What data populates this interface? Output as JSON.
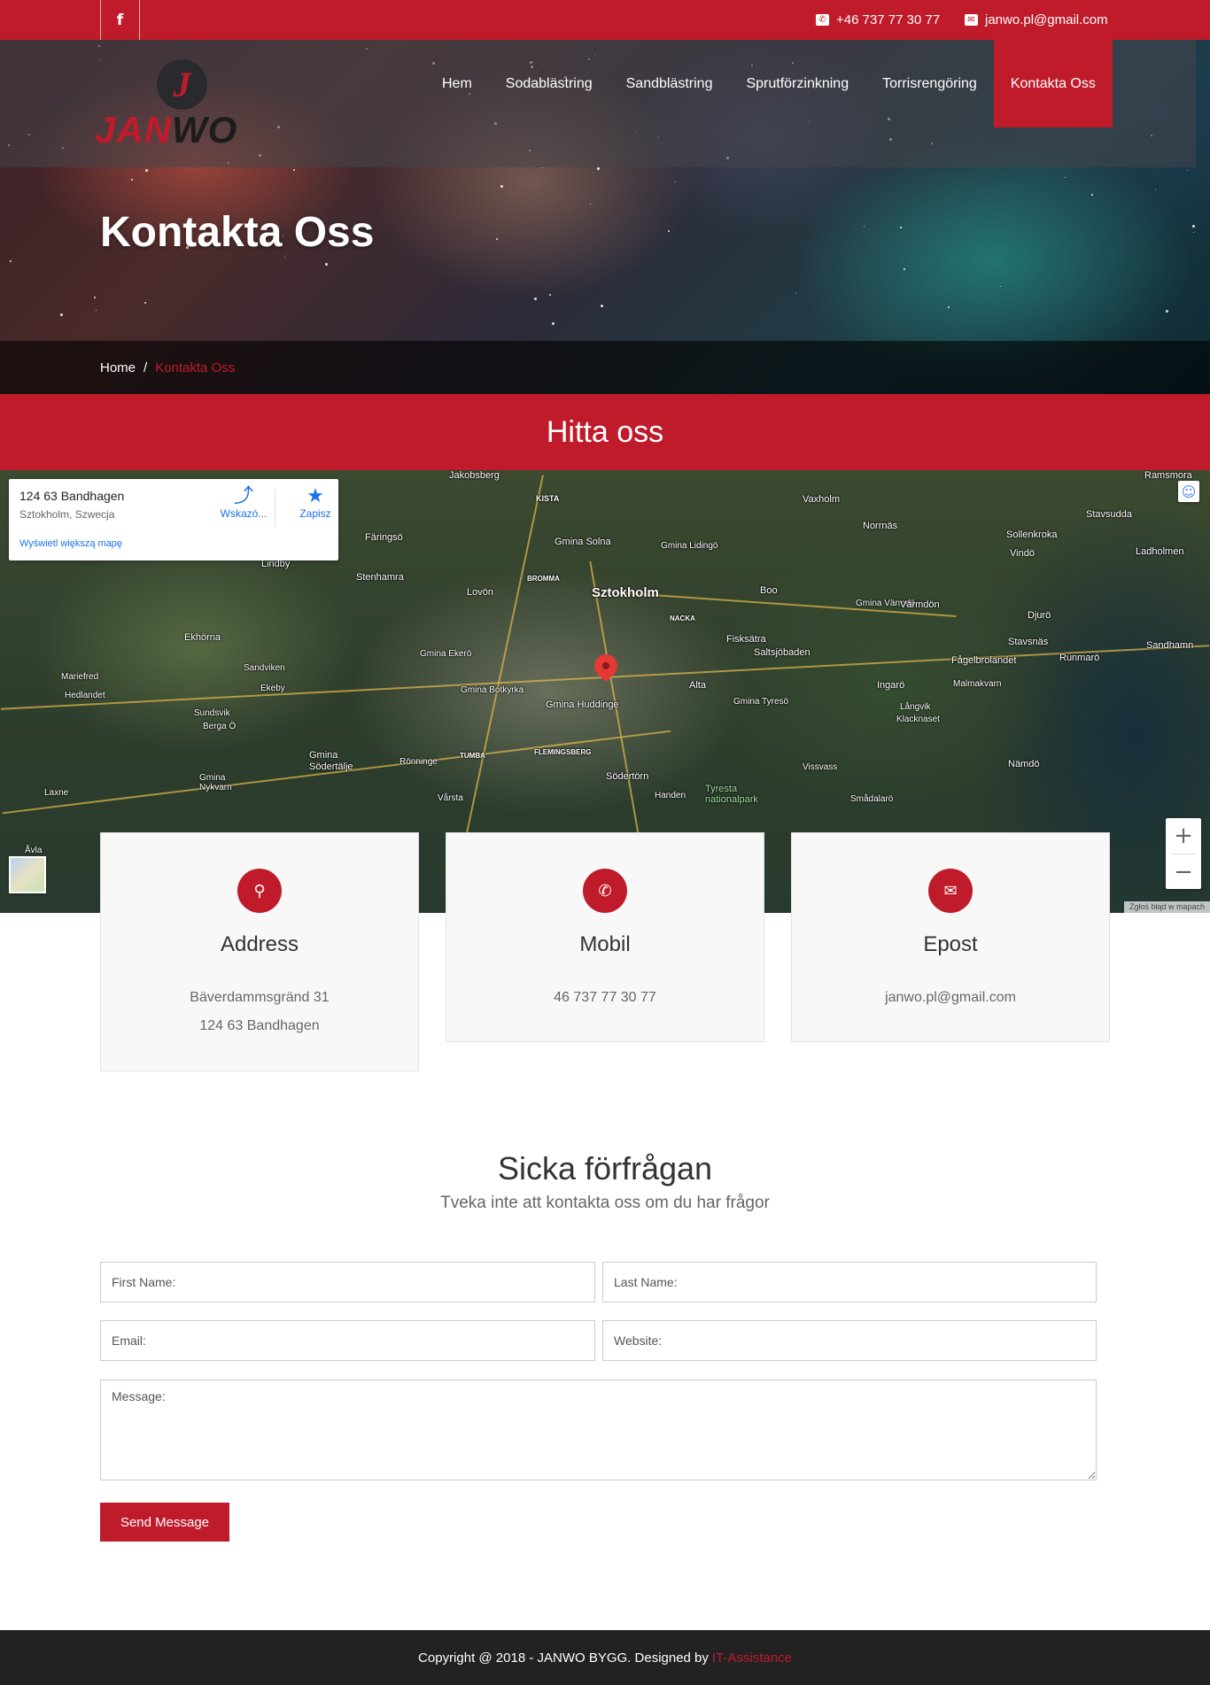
{
  "topbar": {
    "facebook_icon": "f",
    "phone": "+46 737 77 30 77",
    "email": "janwo.pl@gmail.com"
  },
  "brand": {
    "logo_letter": "J",
    "logo_part1": "JAN",
    "logo_part2": "WO"
  },
  "nav": {
    "items": [
      {
        "label": "Hem"
      },
      {
        "label": "Sodablästring"
      },
      {
        "label": "Sandblästring"
      },
      {
        "label": "Sprutförzinkning"
      },
      {
        "label": "Torrisrengöring"
      },
      {
        "label": "Kontakta Oss",
        "active": true
      }
    ]
  },
  "hero": {
    "title": "Kontakta Oss",
    "breadcrumb": {
      "home": "Home",
      "separator": "/",
      "current": "Kontakta Oss"
    }
  },
  "find_us": {
    "title": "Hitta oss"
  },
  "map": {
    "place_title": "124 63 Bandhagen",
    "place_subtitle": "Sztokholm, Szwecja",
    "directions_label": "Wskazó...",
    "save_label": "Zapisz",
    "larger_map_link": "Wyświetl większą mapę",
    "footer_text": "Zgłoś błąd w mapach",
    "zoom_in": "+",
    "zoom_out": "−",
    "labels": {
      "jakobsberg": "Jakobsberg",
      "kista": "KISTA",
      "vaxholm": "Vaxholm",
      "ramsmora": "Ramsmora",
      "stavsudda": "Stavsudda",
      "norrnas": "Norrnäs",
      "sollenkroka": "Sollenkroka",
      "ladholmen": "Ladholmen",
      "vindo": "Vindö",
      "djuro": "Djurö",
      "faringso": "Färingsö",
      "gmina_solna": "Gmina Solna",
      "gmina_lidingo": "Gmina Lidingö",
      "sztokholm": "Sztokholm",
      "bromma": "BROMMA",
      "lindby": "Lindby",
      "stenhamra": "Stenhamra",
      "lovon": "Lovön",
      "boo": "Boo",
      "gmina_varmdo": "Gmina Värmdö",
      "varmdon": "Värmdön",
      "nacka": "NACKA",
      "fisksatra": "Fisksätra",
      "saltsjobaden": "Saltsjöbaden",
      "stavsnas": "Stavsnäs",
      "runmaro": "Runmarö",
      "sandhamn": "Sandhamn",
      "fagelbrolandet": "Fågelbrolandet",
      "malmakvarn": "Malmakvarn",
      "ingaro": "Ingarö",
      "langvik": "Långvik",
      "klacknaset": "Klacknaset",
      "alta": "Alta",
      "gmina_tyreso": "Gmina Tyresö",
      "gmina_ekero": "Gmina Ekerö",
      "gmina_botkyrka": "Gmina Botkyrka",
      "gmina_huddinge": "Gmina Huddinge",
      "flemingsberg": "FLEMINGSBERG",
      "tumba": "TUMBA",
      "ronninge": "Rönninge",
      "sodertorn": "Södertörn",
      "handen": "Handen",
      "tyresta": "Tyresta nationalpark",
      "vissvass": "Vissvass",
      "smadalaro": "Smådalarö",
      "namdo": "Nämdö",
      "ekholma": "Ekhörna",
      "sandviken": "Sandviken",
      "ekeby": "Ekeby",
      "mariefred": "Mariefred",
      "hedlandet": "Hedlandet",
      "sundsvik": "Sundsvik",
      "berga": "Berga Ö",
      "gmina_sodertalje": "Gmina Södertälje",
      "gmina_nykvarn": "Gmina Nykvarn",
      "laxne": "Laxne",
      "varsta": "Vårsta",
      "avla": "Åvla"
    }
  },
  "contact_cards": [
    {
      "icon": "location-pin-icon",
      "glyph": "⚲",
      "title": "Address",
      "lines": [
        "Bäverdammsgränd 31",
        "124 63 Bandhagen"
      ]
    },
    {
      "icon": "phone-icon",
      "glyph": "✆",
      "title": "Mobil",
      "lines": [
        "46 737 77 30 77"
      ]
    },
    {
      "icon": "inbox-icon",
      "glyph": "✉",
      "title": "Epost",
      "lines": [
        "janwo.pl@gmail.com"
      ]
    }
  ],
  "form": {
    "title": "Sicka förfrågan",
    "subtitle": "Tveka inte att kontakta oss om du har frågor",
    "first_name_placeholder": "First Name:",
    "last_name_placeholder": "Last Name:",
    "email_placeholder": "Email:",
    "website_placeholder": "Website:",
    "message_placeholder": "Message:",
    "submit_label": "Send Message"
  },
  "footer": {
    "copyright": "Copyright @ 2018 - JANWO BYGG. Designed by",
    "credit": "IT-Assistance"
  },
  "colors": {
    "brand_red": "#c01b2b",
    "footer_bg": "#222222"
  }
}
